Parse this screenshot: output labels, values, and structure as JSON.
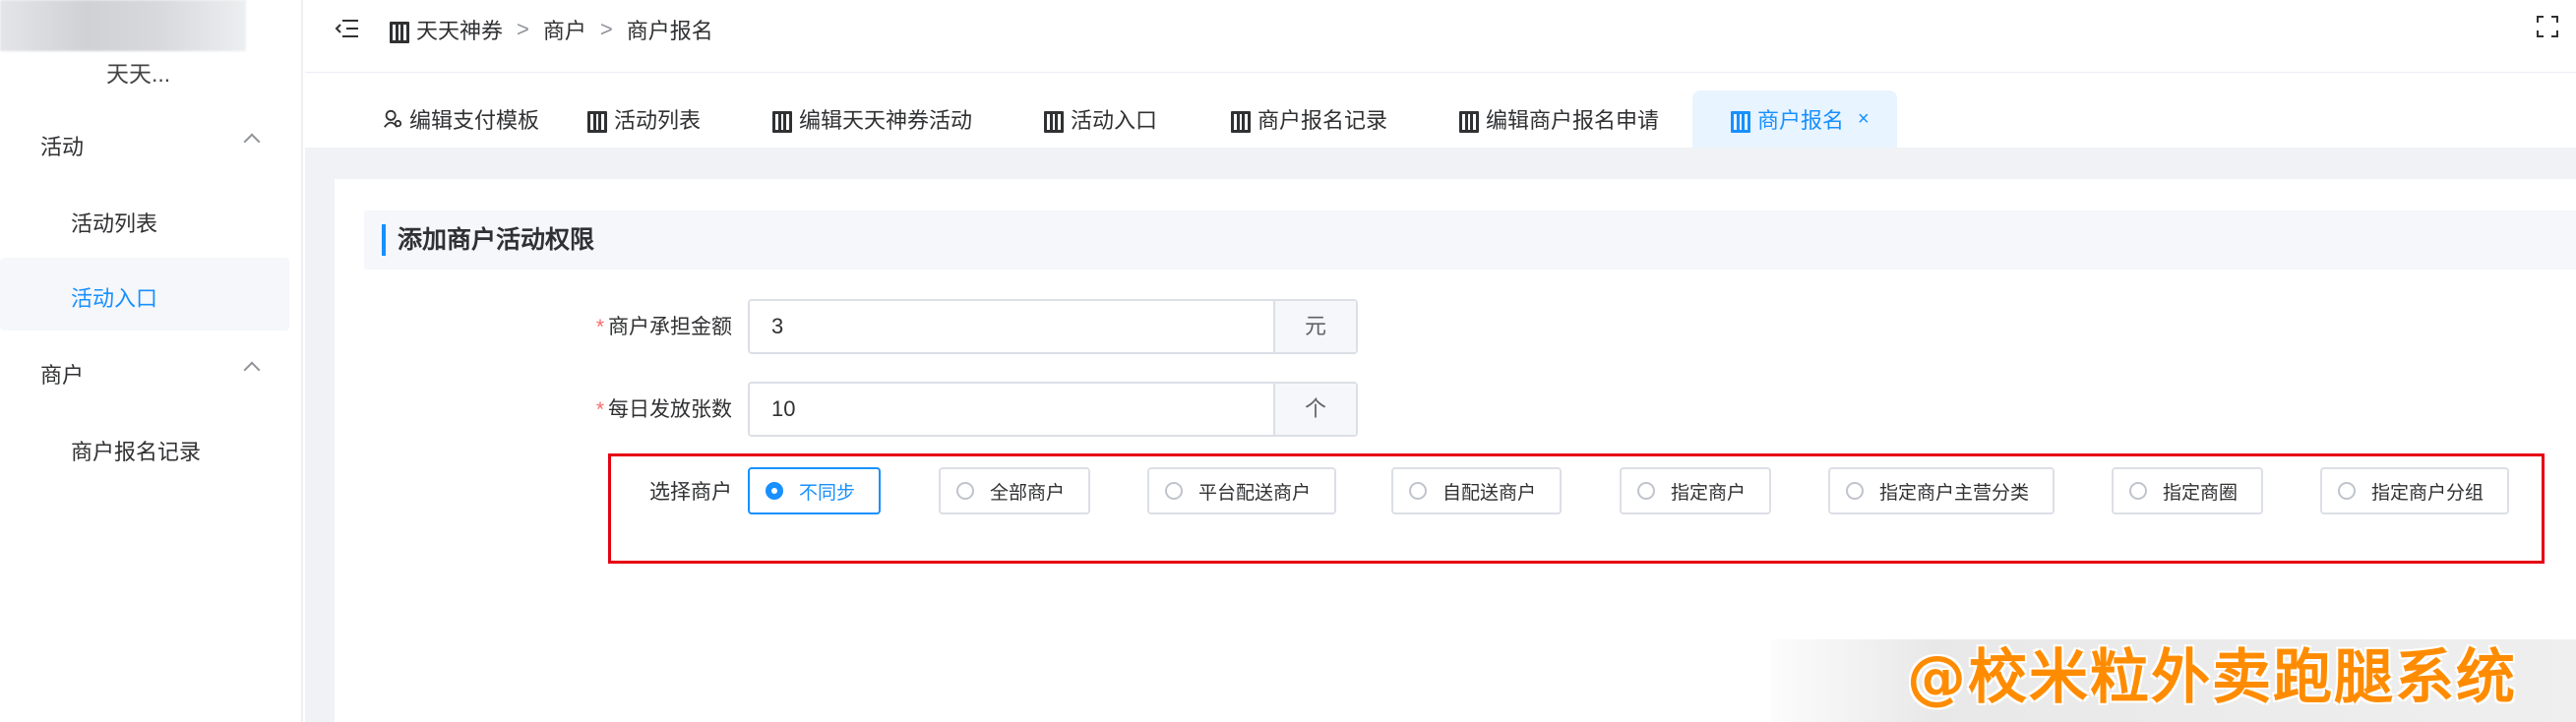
{
  "sidebar": {
    "logo_text": "天天...",
    "groups": [
      {
        "label": "活动",
        "items": [
          "活动列表",
          "活动入口"
        ]
      },
      {
        "label": "商户",
        "items": [
          "商户报名记录"
        ]
      }
    ],
    "active_item": "活动入口"
  },
  "header": {
    "breadcrumb": [
      "天天神券",
      "商户",
      "商户报名"
    ]
  },
  "tabs": [
    {
      "label": "编辑支付模板",
      "icon": "user-icon"
    },
    {
      "label": "活动列表",
      "icon": "book-icon"
    },
    {
      "label": "编辑天天神券活动",
      "icon": "book-icon"
    },
    {
      "label": "活动入口",
      "icon": "book-icon"
    },
    {
      "label": "商户报名记录",
      "icon": "book-icon"
    },
    {
      "label": "编辑商户报名申请",
      "icon": "book-icon"
    },
    {
      "label": "商户报名",
      "icon": "book-icon",
      "active": true
    }
  ],
  "form": {
    "title": "添加商户活动权限",
    "merchant_amount": {
      "label": "商户承担金额",
      "value": "3",
      "unit": "元"
    },
    "daily_count": {
      "label": "每日发放张数",
      "value": "10",
      "unit": "个"
    },
    "select_merchant": {
      "label": "选择商户",
      "options": [
        "不同步",
        "全部商户",
        "平台配送商户",
        "自配送商户",
        "指定商户",
        "指定商户主营分类",
        "指定商圈",
        "指定商户分组"
      ],
      "selected": "不同步"
    }
  },
  "watermark": "@校米粒外卖跑腿系统",
  "colors": {
    "accent": "#1890ff",
    "highlight_border": "#e60012",
    "watermark": "#ff8c00"
  }
}
